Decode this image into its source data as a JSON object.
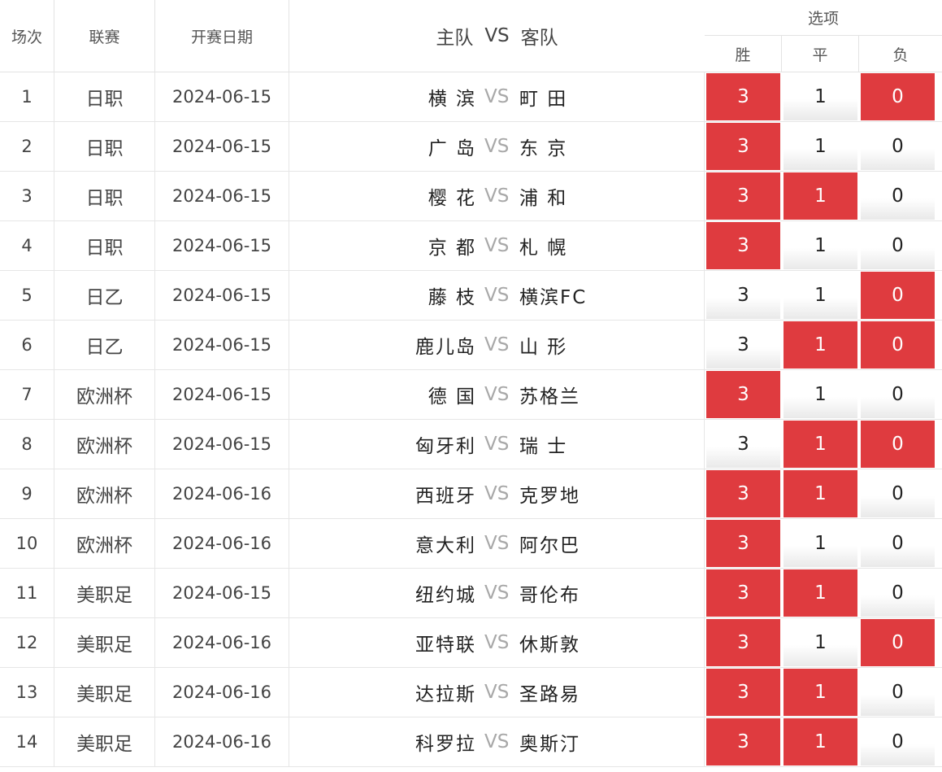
{
  "header": {
    "no": "场次",
    "league": "联赛",
    "date": "开赛日期",
    "home": "主队",
    "vs": "VS",
    "away": "客队",
    "options": "选项",
    "win": "胜",
    "draw": "平",
    "lose": "负"
  },
  "colors": {
    "selected": "#df3b3f",
    "vs_text": "#a8a8a8"
  },
  "matches": [
    {
      "no": "1",
      "league": "日职",
      "date": "2024-06-15",
      "home": "横 滨",
      "vs": "VS",
      "away": "町 田",
      "win": "3",
      "draw": "1",
      "lose": "0",
      "win_selected": true,
      "draw_selected": false,
      "lose_selected": true
    },
    {
      "no": "2",
      "league": "日职",
      "date": "2024-06-15",
      "home": "广 岛",
      "vs": "VS",
      "away": "东 京",
      "win": "3",
      "draw": "1",
      "lose": "0",
      "win_selected": true,
      "draw_selected": false,
      "lose_selected": false
    },
    {
      "no": "3",
      "league": "日职",
      "date": "2024-06-15",
      "home": "樱 花",
      "vs": "VS",
      "away": "浦 和",
      "win": "3",
      "draw": "1",
      "lose": "0",
      "win_selected": true,
      "draw_selected": true,
      "lose_selected": false
    },
    {
      "no": "4",
      "league": "日职",
      "date": "2024-06-15",
      "home": "京 都",
      "vs": "VS",
      "away": "札 幌",
      "win": "3",
      "draw": "1",
      "lose": "0",
      "win_selected": true,
      "draw_selected": false,
      "lose_selected": false
    },
    {
      "no": "5",
      "league": "日乙",
      "date": "2024-06-15",
      "home": "藤 枝",
      "vs": "VS",
      "away": "横滨FC",
      "win": "3",
      "draw": "1",
      "lose": "0",
      "win_selected": false,
      "draw_selected": false,
      "lose_selected": true
    },
    {
      "no": "6",
      "league": "日乙",
      "date": "2024-06-15",
      "home": "鹿儿岛",
      "vs": "VS",
      "away": "山 形",
      "win": "3",
      "draw": "1",
      "lose": "0",
      "win_selected": false,
      "draw_selected": true,
      "lose_selected": true
    },
    {
      "no": "7",
      "league": "欧洲杯",
      "date": "2024-06-15",
      "home": "德 国",
      "vs": "VS",
      "away": "苏格兰",
      "win": "3",
      "draw": "1",
      "lose": "0",
      "win_selected": true,
      "draw_selected": false,
      "lose_selected": false
    },
    {
      "no": "8",
      "league": "欧洲杯",
      "date": "2024-06-15",
      "home": "匈牙利",
      "vs": "VS",
      "away": "瑞 士",
      "win": "3",
      "draw": "1",
      "lose": "0",
      "win_selected": false,
      "draw_selected": true,
      "lose_selected": true
    },
    {
      "no": "9",
      "league": "欧洲杯",
      "date": "2024-06-16",
      "home": "西班牙",
      "vs": "VS",
      "away": "克罗地",
      "win": "3",
      "draw": "1",
      "lose": "0",
      "win_selected": true,
      "draw_selected": true,
      "lose_selected": false
    },
    {
      "no": "10",
      "league": "欧洲杯",
      "date": "2024-06-16",
      "home": "意大利",
      "vs": "VS",
      "away": "阿尔巴",
      "win": "3",
      "draw": "1",
      "lose": "0",
      "win_selected": true,
      "draw_selected": false,
      "lose_selected": false
    },
    {
      "no": "11",
      "league": "美职足",
      "date": "2024-06-15",
      "home": "纽约城",
      "vs": "VS",
      "away": "哥伦布",
      "win": "3",
      "draw": "1",
      "lose": "0",
      "win_selected": true,
      "draw_selected": true,
      "lose_selected": false
    },
    {
      "no": "12",
      "league": "美职足",
      "date": "2024-06-16",
      "home": "亚特联",
      "vs": "VS",
      "away": "休斯敦",
      "win": "3",
      "draw": "1",
      "lose": "0",
      "win_selected": true,
      "draw_selected": false,
      "lose_selected": true
    },
    {
      "no": "13",
      "league": "美职足",
      "date": "2024-06-16",
      "home": "达拉斯",
      "vs": "VS",
      "away": "圣路易",
      "win": "3",
      "draw": "1",
      "lose": "0",
      "win_selected": true,
      "draw_selected": true,
      "lose_selected": false
    },
    {
      "no": "14",
      "league": "美职足",
      "date": "2024-06-16",
      "home": "科罗拉",
      "vs": "VS",
      "away": "奥斯汀",
      "win": "3",
      "draw": "1",
      "lose": "0",
      "win_selected": true,
      "draw_selected": true,
      "lose_selected": false
    }
  ]
}
